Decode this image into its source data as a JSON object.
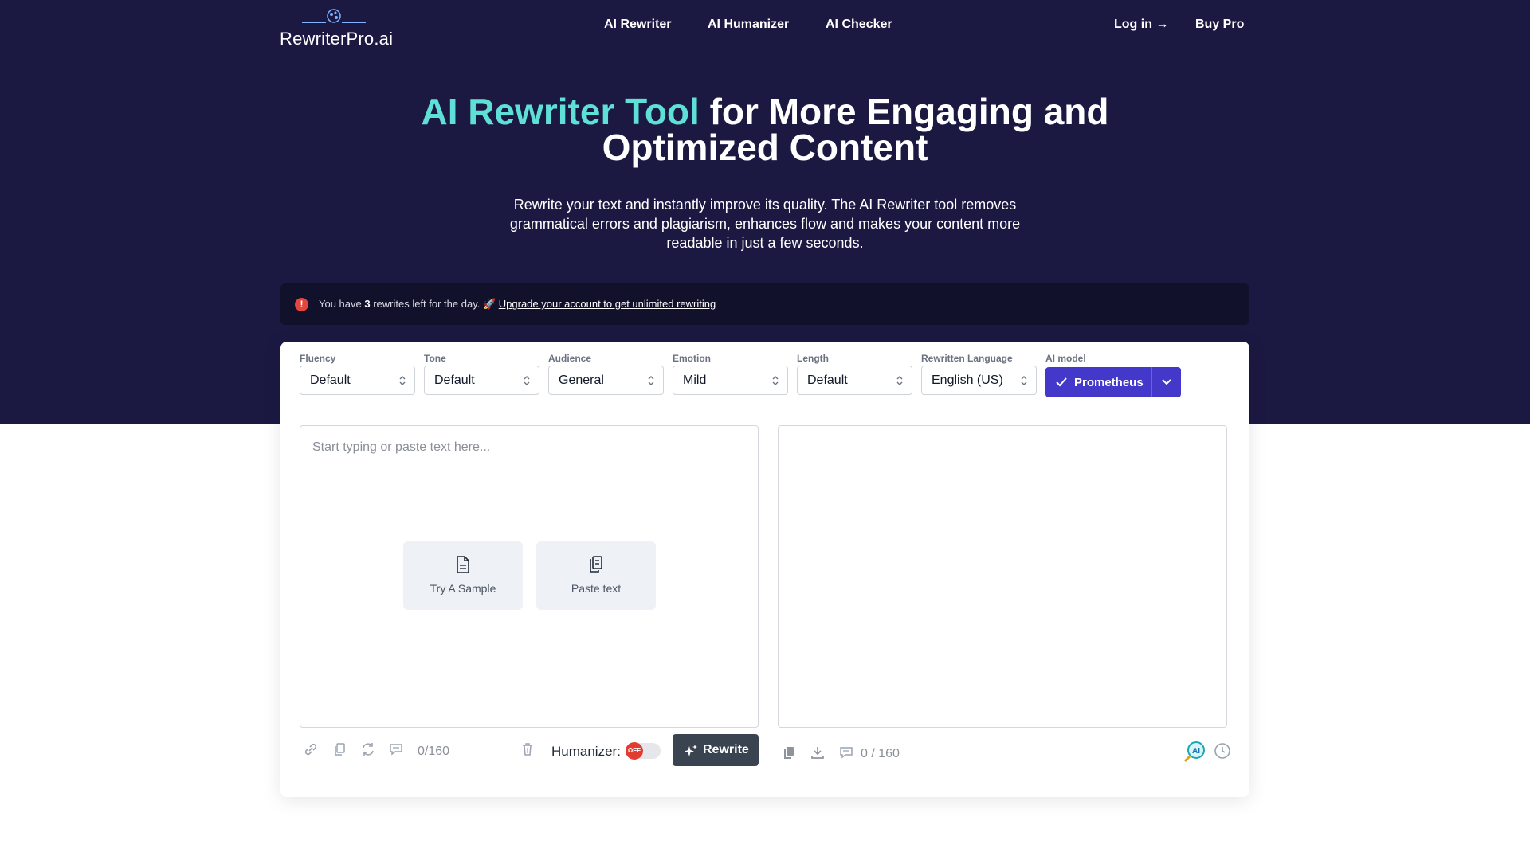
{
  "header": {
    "logo_text": "RewriterPro.ai",
    "nav": [
      "AI Rewriter",
      "AI Humanizer",
      "AI Checker"
    ],
    "login": "Log in →",
    "buy": "Buy Pro"
  },
  "hero": {
    "title_accent": "AI Rewriter Tool",
    "title_rest": " for More Engaging and Optimized Content",
    "subtitle": "Rewrite your text and instantly improve its quality. The AI Rewriter tool removes grammatical errors and plagiarism, enhances flow and makes your content more readable in just a few seconds."
  },
  "notice": {
    "prefix": "You have ",
    "count": "3",
    "suffix": " rewrites left for the day. 🚀 ",
    "link": "Upgrade your account to get unlimited rewriting"
  },
  "options": [
    {
      "label": "Fluency",
      "value": "Default"
    },
    {
      "label": "Tone",
      "value": "Default"
    },
    {
      "label": "Audience",
      "value": "General"
    },
    {
      "label": "Emotion",
      "value": "Mild"
    },
    {
      "label": "Length",
      "value": "Default"
    },
    {
      "label": "Rewritten Language",
      "value": "English (US)"
    }
  ],
  "model": {
    "label": "AI model",
    "value": "Prometheus"
  },
  "editor": {
    "placeholder": "Start typing or paste text here...",
    "sample_button": "Try A Sample",
    "paste_button": "Paste text",
    "input_count": "0/160",
    "output_count": "0 / 160"
  },
  "toolbar": {
    "humanizer_label": "Humanizer:",
    "toggle_state": "OFF",
    "rewrite_button": "Rewrite"
  },
  "colors": {
    "hero_bg": "#1b1942",
    "accent": "#5ee0d6",
    "primary": "#4338ca",
    "danger": "#e2463d"
  }
}
